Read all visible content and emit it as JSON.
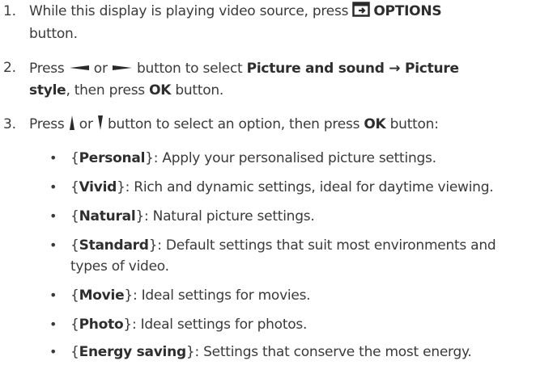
{
  "steps": [
    {
      "number": "1.",
      "before": "While this display is playing video source, press ",
      "options_label": "OPTIONS",
      "after_line": "button."
    },
    {
      "number": "2.",
      "press": "Press ",
      "or": " or ",
      "mid": " button to select ",
      "path_1": "Picture and sound",
      "arrow": " → ",
      "path_2a": "Picture",
      "path_2b": "style",
      "then": ", then press ",
      "ok": "OK",
      "end": " button."
    },
    {
      "number": "3.",
      "press": "Press ",
      "or": " or ",
      "mid": " button to select an option, then press ",
      "ok": "OK",
      "end": " button:"
    }
  ],
  "options": [
    {
      "bullet": "•",
      "open": "{",
      "name": "Personal",
      "close": "}",
      "desc": ": Apply your personalised picture settings."
    },
    {
      "bullet": "•",
      "open": "{",
      "name": "Vivid",
      "close": "}",
      "desc": ": Rich and dynamic settings, ideal for daytime viewing."
    },
    {
      "bullet": "•",
      "open": "{",
      "name": "Natural",
      "close": "}",
      "desc": ": Natural picture settings."
    },
    {
      "bullet": "•",
      "open": "{",
      "name": "Standard",
      "close": "}",
      "desc": ": Default settings that suit most environments and",
      "desc_line2": "types of video."
    },
    {
      "bullet": "•",
      "open": "{",
      "name": "Movie",
      "close": "}",
      "desc": ": Ideal settings for movies."
    },
    {
      "bullet": "•",
      "open": "{",
      "name": "Photo",
      "close": "}",
      "desc": ": Ideal settings for photos."
    },
    {
      "bullet": "•",
      "open": "{",
      "name": "Energy saving",
      "close": "}",
      "desc": ": Settings that conserve the most energy."
    }
  ]
}
